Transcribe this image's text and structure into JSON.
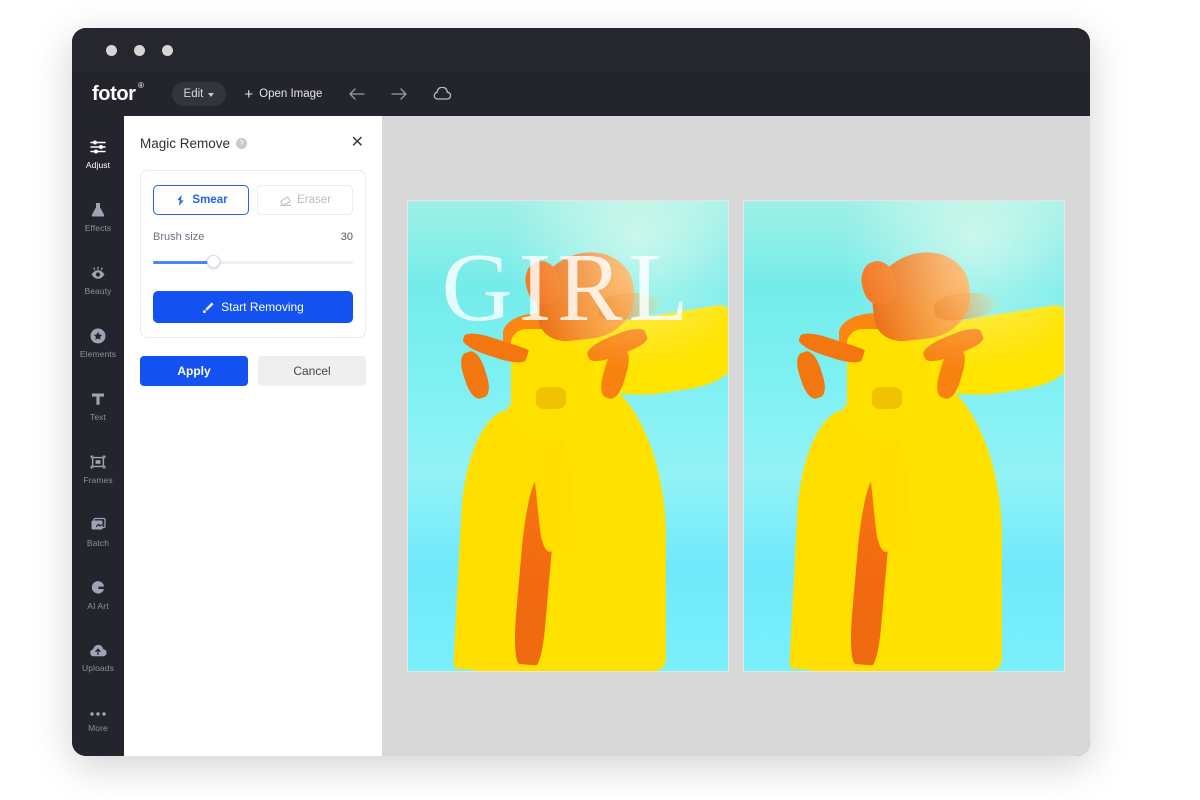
{
  "window": {
    "traffic_lights": [
      "dot-1",
      "dot-2",
      "dot-3"
    ]
  },
  "toolbar": {
    "logo": "fotor",
    "logo_registered": "®",
    "edit_label": "Edit",
    "open_image_label": "Open Image",
    "plus_symbol": "+",
    "icons": [
      "undo-arrow-icon",
      "redo-arrow-icon",
      "cloud-icon"
    ]
  },
  "sidebar": {
    "items": [
      {
        "label": "Adjust",
        "icon": "sliders-icon",
        "active": true
      },
      {
        "label": "Effects",
        "icon": "flask-icon",
        "active": false
      },
      {
        "label": "Beauty",
        "icon": "eye-icon",
        "active": false
      },
      {
        "label": "Elements",
        "icon": "star-icon",
        "active": false
      },
      {
        "label": "Text",
        "icon": "text-t-icon",
        "active": false
      },
      {
        "label": "Frames",
        "icon": "frame-icon",
        "active": false
      },
      {
        "label": "Batch",
        "icon": "batch-icon",
        "active": false
      },
      {
        "label": "AI Art",
        "icon": "ai-art-icon",
        "active": false
      },
      {
        "label": "Uploads",
        "icon": "upload-cloud-icon",
        "active": false
      },
      {
        "label": "More",
        "icon": "ellipsis-icon",
        "active": false
      }
    ]
  },
  "panel": {
    "title": "Magic Remove",
    "help_icon": "question-mark-icon",
    "close_icon": "close-icon",
    "close_glyph": "✕",
    "help_glyph": "?",
    "tabs": [
      {
        "label": "Smear",
        "icon": "smear-brush-icon",
        "active": true
      },
      {
        "label": "Eraser",
        "icon": "eraser-icon",
        "active": false
      }
    ],
    "brush_size_label": "Brush size",
    "brush_size_value": "30",
    "brush_size_percent": 30,
    "start_button_label": "Start Removing",
    "start_button_icon": "magic-wand-icon",
    "apply_label": "Apply",
    "cancel_label": "Cancel"
  },
  "canvas": {
    "before_image_overlay_text": "GIRL",
    "after_image_overlay_text": ""
  },
  "colors": {
    "accent_blue": "#1352f0",
    "tab_active_blue": "#2563f0",
    "window_dark": "#23242c",
    "titlebar_dark": "#26272e",
    "canvas_gray": "#d8d8d8",
    "panel_white": "#ffffff",
    "dress_yellow": "#ffe100",
    "skin_orange": "#f4760f",
    "sky_cyan": "#74ecea"
  }
}
